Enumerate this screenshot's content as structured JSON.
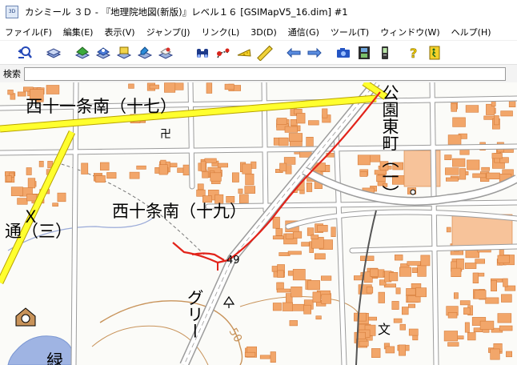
{
  "window": {
    "title": "カシミール ３Ｄ - 『地理院地図(新版)』レベル１６ [GSIMapV5_16.dim] #1",
    "app_icon_text": "3D"
  },
  "menu": [
    "ファイル(F)",
    "編集(E)",
    "表示(V)",
    "ジャンプ(J)",
    "リンク(L)",
    "3D(D)",
    "通信(G)",
    "ツール(T)",
    "ウィンドウ(W)",
    "ヘルプ(H)"
  ],
  "toolbar": {
    "icons": [
      "zoom-search-icon",
      "layers-icon",
      "layer-green-icon",
      "layer-blue-icon",
      "layer-yellow-icon",
      "layer-edit-icon",
      "layer-red-icon",
      "binoculars-icon",
      "route-marker-icon",
      "cheese-icon",
      "ruler-icon",
      "arrow-left-icon",
      "arrow-right-icon",
      "camera-icon",
      "film-icon",
      "gps-icon",
      "help-icon",
      "exit-icon"
    ]
  },
  "search": {
    "label": "検索",
    "value": ""
  },
  "map": {
    "place_names": {
      "nishi11": "西十一条南（十七）",
      "nishi10": "西十条南（十九）",
      "koen": "公園東町（一）",
      "x_char": "Ｘ",
      "dori": "通（三）",
      "green": "グリー",
      "midori": "緑",
      "num49": "49",
      "num50": "50"
    },
    "colors": {
      "background": "#fbfbf8",
      "building": "#f2a66a",
      "building_stroke": "#d57c3a",
      "road_main": "#ffff2e",
      "road_minor": "#ffffff",
      "road_edge": "#9c9c9c",
      "track": "#e2231a",
      "water": "#9fb4e3",
      "contour": "#c8935a",
      "railway": "#555555"
    },
    "symbols": [
      "temple-icon",
      "school-icon",
      "post-office-icon",
      "shrine-icon",
      "tree-icon"
    ]
  }
}
